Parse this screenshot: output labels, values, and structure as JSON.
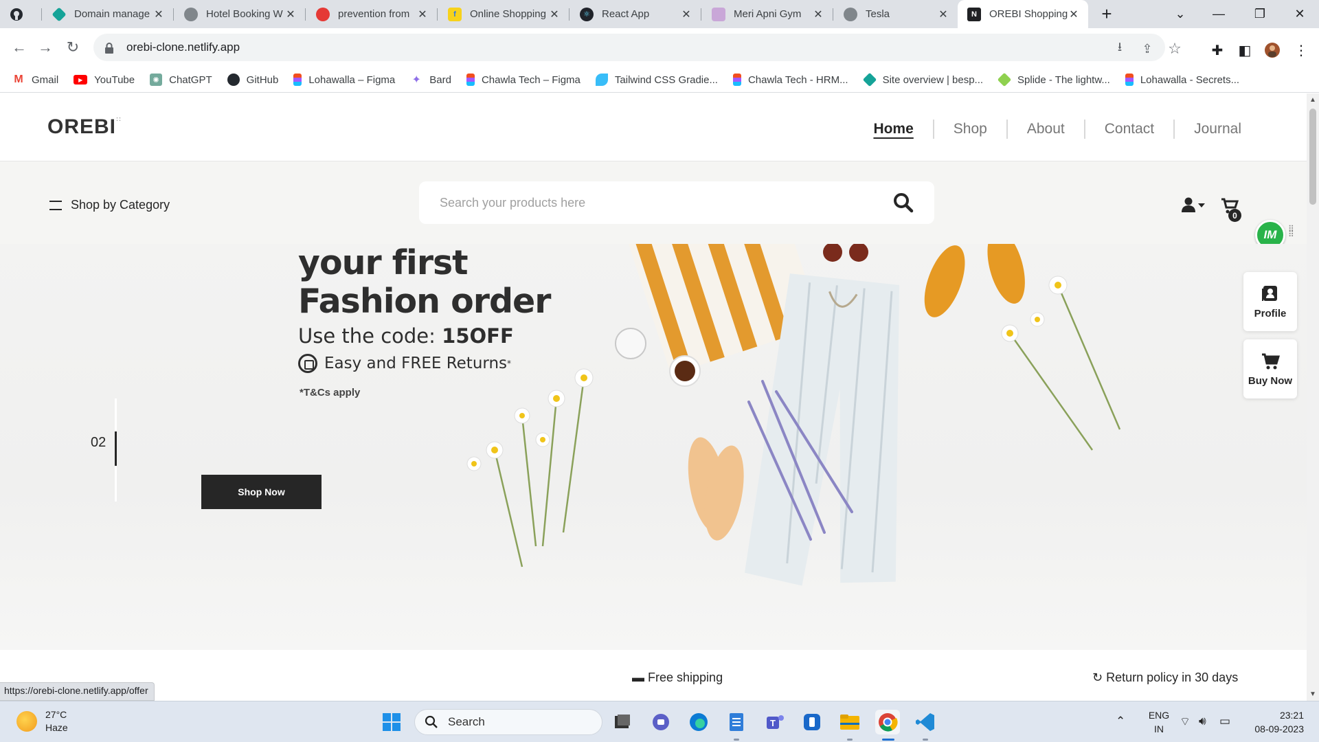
{
  "browser": {
    "tabs": [
      {
        "title": "",
        "favicon": "github-icon"
      },
      {
        "title": "Domain manage",
        "favicon": "domain-icon"
      },
      {
        "title": "Hotel Booking W",
        "favicon": "globe-icon"
      },
      {
        "title": "prevention from",
        "favicon": "virus-icon"
      },
      {
        "title": "Online Shopping",
        "favicon": "flipkart-icon"
      },
      {
        "title": "React App",
        "favicon": "react-icon"
      },
      {
        "title": "Meri Apni Gym",
        "favicon": "gym-icon"
      },
      {
        "title": "Tesla",
        "favicon": "globe-icon"
      },
      {
        "title": "OREBI Shopping",
        "favicon": "orebi-icon",
        "active": true
      }
    ],
    "url": "orebi-clone.netlify.app",
    "bookmarks": [
      {
        "label": "Gmail",
        "icon": "gmail-icon",
        "color": "#ea4335"
      },
      {
        "label": "YouTube",
        "icon": "youtube-icon",
        "color": "#ff0000"
      },
      {
        "label": "ChatGPT",
        "icon": "chatgpt-icon",
        "color": "#74aa9c"
      },
      {
        "label": "GitHub",
        "icon": "github-icon",
        "color": "#24292f"
      },
      {
        "label": "Lohawalla – Figma",
        "icon": "figma-icon",
        "color": "#f24e1e"
      },
      {
        "label": "Bard",
        "icon": "bard-icon",
        "color": "#8e6fe8"
      },
      {
        "label": "Chawla Tech – Figma",
        "icon": "figma-icon",
        "color": "#f24e1e"
      },
      {
        "label": "Tailwind CSS Gradie...",
        "icon": "tailwind-icon",
        "color": "#38bdf8"
      },
      {
        "label": "Chawla Tech - HRM...",
        "icon": "figma-icon",
        "color": "#f24e1e"
      },
      {
        "label": "Site overview | besp...",
        "icon": "netlify-icon",
        "color": "#15a398"
      },
      {
        "label": "Splide - The lightw...",
        "icon": "splide-icon",
        "color": "#8fd14f"
      },
      {
        "label": "Lohawalla - Secrets...",
        "icon": "figma-icon",
        "color": "#f24e1e"
      }
    ],
    "status_url": "https://orebi-clone.netlify.app/offer"
  },
  "site": {
    "logo": "OREBI",
    "nav": [
      "Home",
      "Shop",
      "About",
      "Contact",
      "Journal"
    ],
    "active_nav": "Home",
    "category_label": "Shop by Category",
    "search_placeholder": "Search your products here",
    "cart_count": "0",
    "ext_badge": "IM",
    "hero": {
      "line1": "your first",
      "line2": "Fashion order",
      "code_prefix": "Use the code: ",
      "code": "15OFF",
      "returns": "Easy and FREE Returns",
      "returns_mark": "*",
      "tcs": "*T&Cs apply",
      "slide_number": "02",
      "cta": "Shop Now"
    },
    "side_widgets": [
      {
        "label": "Profile",
        "icon": "profile-icon"
      },
      {
        "label": "Buy Now",
        "icon": "cart-icon"
      }
    ],
    "below_fold": [
      "Free shipping",
      "Return policy in 30 days"
    ]
  },
  "taskbar": {
    "weather_temp": "27°C",
    "weather_desc": "Haze",
    "search_label": "Search",
    "lang1": "ENG",
    "lang2": "IN",
    "time": "23:21",
    "date": "08-09-2023"
  },
  "colors": {
    "accent": "#262626",
    "hero_bg": "#f3f3f2",
    "category_bar_bg": "#f5f5f3",
    "taskbar_bg": "#dfe6f0"
  }
}
